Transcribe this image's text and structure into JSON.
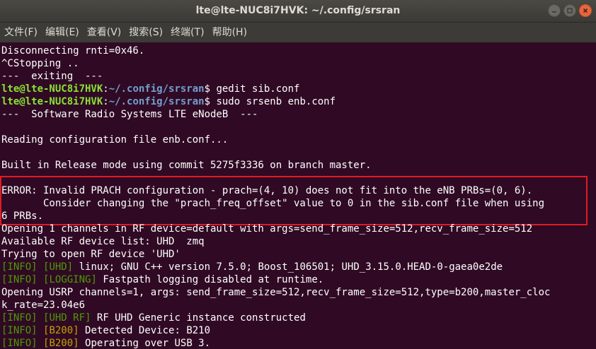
{
  "window": {
    "title": "lte@lte-NUC8i7HVK: ~/.config/srsran"
  },
  "menubar": {
    "items": [
      "文件(F)",
      "编辑(E)",
      "查看(V)",
      "搜索(S)",
      "终端(T)",
      "帮助(H)"
    ]
  },
  "terminal": {
    "prompt_user": "lte@lte-NUC8i7HVK",
    "prompt_path": "~/.config/srsran",
    "lines": [
      "Disconnecting rnti=0x46.",
      "^CStopping ..",
      "---  exiting  ---",
      "gedit sib.conf",
      "sudo srsenb enb.conf",
      "---  Software Radio Systems LTE eNodeB  ---",
      "",
      "Reading configuration file enb.conf...",
      "",
      "Built in Release mode using commit 5275f3336 on branch master.",
      "",
      "ERROR: Invalid PRACH configuration - prach=(4, 10) does not fit into the eNB PRBs=(0, 6).",
      "       Consider changing the \"prach_freq_offset\" value to 0 in the sib.conf file when using",
      "6 PRBs.",
      "Opening 1 channels in RF device=default with args=send_frame_size=512,recv_frame_size=512",
      "Available RF device list: UHD  zmq",
      "Trying to open RF device 'UHD'",
      "linux; GNU C++ version 7.5.0; Boost_106501; UHD_3.15.0.HEAD-0-gaea0e2de",
      "Fastpath logging disabled at runtime.",
      "Opening USRP channels=1, args: send_frame_size=512,recv_frame_size=512,type=b200,master_cloc",
      "k_rate=23.04e6",
      "RF UHD Generic instance constructed",
      "Detected Device: B210",
      "Operating over USB 3."
    ],
    "tags": {
      "info": "[INFO]",
      "uhd": "[UHD]",
      "logging": "[LOGGING]",
      "uhd_rf": "[UHD RF]",
      "b200": "[B200]"
    }
  },
  "colors": {
    "background": "#300a24",
    "prompt_user": "#8ae234",
    "prompt_path": "#729fcf",
    "info_tag": "#4e9a06",
    "sub_tag": "#c4a000",
    "highlight_border": "#e01b24"
  },
  "icons": {
    "minimize": "minimize-icon",
    "maximize": "maximize-icon",
    "close": "close-icon"
  }
}
